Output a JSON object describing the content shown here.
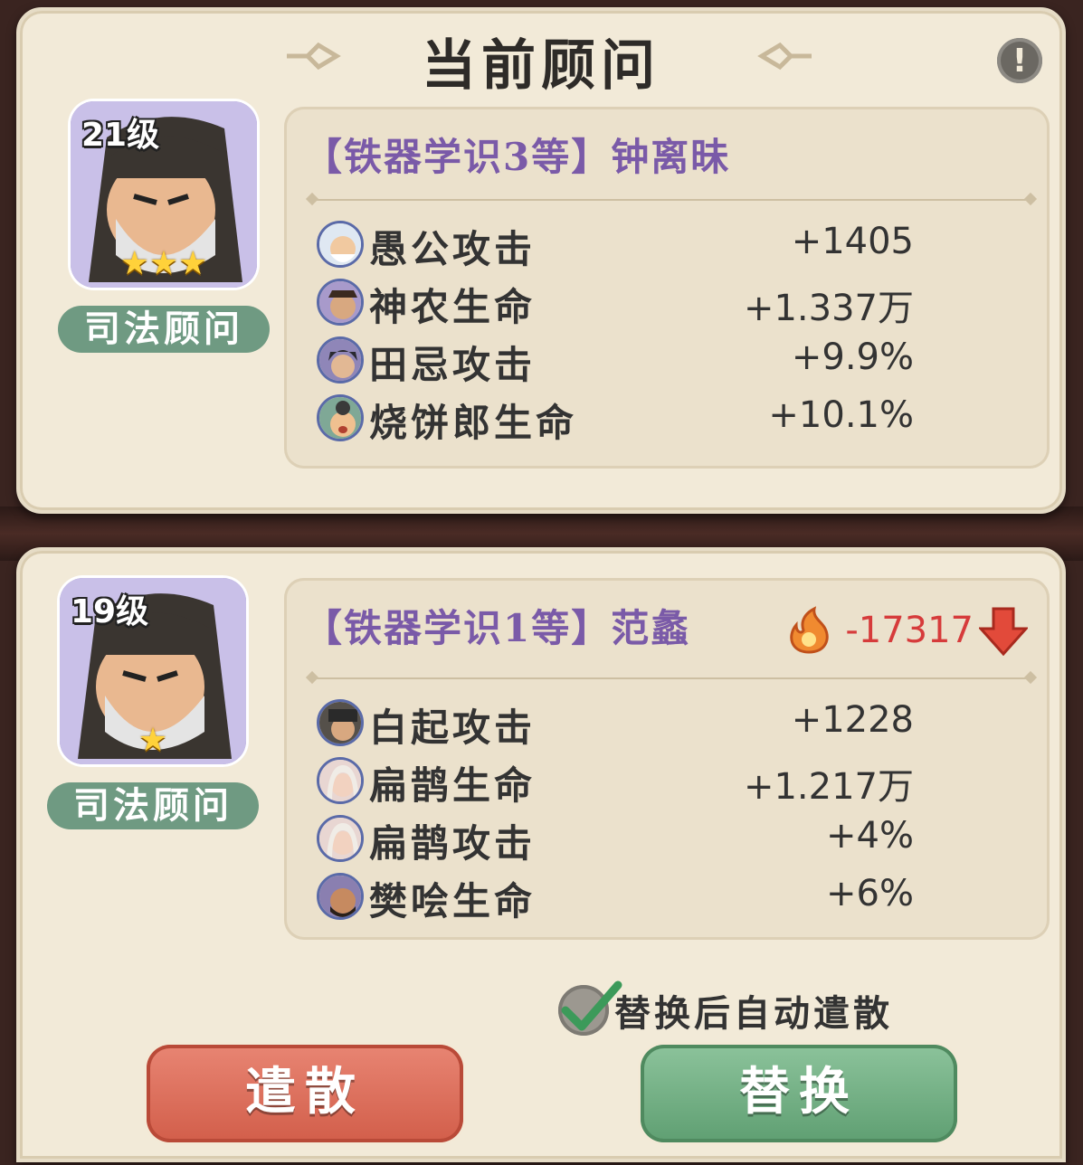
{
  "dialog": {
    "title": "当前顾问",
    "info_icon": "exclamation-icon"
  },
  "current_advisor": {
    "level": "21级",
    "stars": "★★★",
    "role": "司法顾问",
    "name": "【铁器学识3等】钟离昧",
    "stats": [
      {
        "avatar": "yugong-avatar",
        "name": "愚公攻击",
        "value": "+1405"
      },
      {
        "avatar": "shennong-avatar",
        "name": "神农生命",
        "value": "+1.337万"
      },
      {
        "avatar": "tianji-avatar",
        "name": "田忌攻击",
        "value": "+9.9%"
      },
      {
        "avatar": "shaobinglang-avatar",
        "name": "烧饼郎生命",
        "value": "+10.1%"
      }
    ]
  },
  "new_advisor": {
    "level": "19级",
    "stars": "★",
    "role": "司法顾问",
    "name": "【铁器学识1等】范蠡",
    "power_change": "-17317",
    "power_icon": "flame-power-icon",
    "trend_icon": "red-down-arrow-icon",
    "stats": [
      {
        "avatar": "baiqi-avatar",
        "name": "白起攻击",
        "value": "+1228"
      },
      {
        "avatar": "bianque-avatar",
        "name": "扁鹊生命",
        "value": "+1.217万"
      },
      {
        "avatar": "bianque-avatar",
        "name": "扁鹊攻击",
        "value": "+4%"
      },
      {
        "avatar": "fankuai-avatar",
        "name": "樊哙生命",
        "value": "+6%"
      }
    ]
  },
  "auto_dismiss": {
    "label": "替换后自动遣散",
    "checked": true
  },
  "buttons": {
    "dismiss": "遣散",
    "replace": "替换"
  },
  "colors": {
    "accent_purple": "#7a5aa8",
    "power_red": "#d63b3b",
    "dismiss_red": "#d25e4a",
    "replace_green": "#5f9f72"
  }
}
